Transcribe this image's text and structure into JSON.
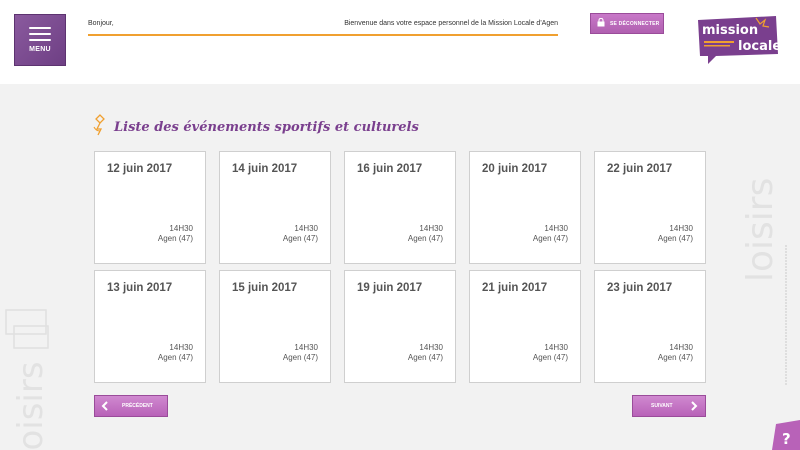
{
  "header": {
    "menu_label": "MENU",
    "greeting": "Bonjour,",
    "welcome": "Bienvenue dans votre espace personnel de la Mission Locale d'Agen",
    "logout_label": "SE DÉCONNECTER",
    "logo_line1": "mission",
    "logo_line2": "locale"
  },
  "main": {
    "title": "Liste des événements sportifs et culturels",
    "events": [
      {
        "date": "12 juin 2017",
        "time": "14H30",
        "place": "Agen (47)"
      },
      {
        "date": "14 juin 2017",
        "time": "14H30",
        "place": "Agen (47)"
      },
      {
        "date": "16 juin 2017",
        "time": "14H30",
        "place": "Agen (47)"
      },
      {
        "date": "20 juin 2017",
        "time": "14H30",
        "place": "Agen (47)"
      },
      {
        "date": "22 juin 2017",
        "time": "14H30",
        "place": "Agen (47)"
      },
      {
        "date": "13 juin 2017",
        "time": "14H30",
        "place": "Agen (47)"
      },
      {
        "date": "15 juin 2017",
        "time": "14H30",
        "place": "Agen (47)"
      },
      {
        "date": "19 juin 2017",
        "time": "14H30",
        "place": "Agen (47)"
      },
      {
        "date": "21 juin 2017",
        "time": "14H30",
        "place": "Agen (47)"
      },
      {
        "date": "23 juin 2017",
        "time": "14H30",
        "place": "Agen (47)"
      }
    ]
  },
  "pager": {
    "prev_label": "PRÉCÉDENT",
    "next_label": "SUIVANT"
  },
  "decor": {
    "watermark": "loisirs"
  },
  "help": {
    "label": "?"
  },
  "colors": {
    "brand_purple": "#7a3f8e",
    "button_pink": "#c070c0",
    "accent_orange": "#f0a030"
  }
}
